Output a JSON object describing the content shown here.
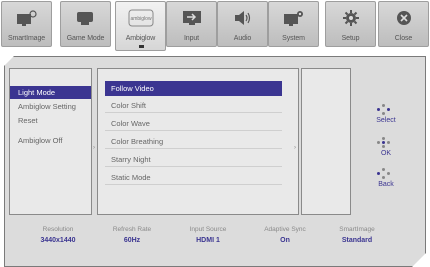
{
  "tabs": [
    {
      "label": "SmartImage",
      "icon": "smartimage-icon",
      "active": false
    },
    {
      "label": "Game Mode",
      "icon": "gamepad-icon",
      "active": false
    },
    {
      "label": "Ambiglow",
      "icon": "ambiglow-icon",
      "icon_text": "ambiglow",
      "active": true
    },
    {
      "label": "Input",
      "icon": "input-icon",
      "active": false
    },
    {
      "label": "Audio",
      "icon": "speaker-icon",
      "active": false
    },
    {
      "label": "System",
      "icon": "system-icon",
      "active": false
    },
    {
      "label": "Setup",
      "icon": "gear-icon",
      "active": false
    },
    {
      "label": "Close",
      "icon": "close-icon",
      "active": false
    }
  ],
  "menu": {
    "level1": [
      {
        "label": "Light Mode",
        "selected": true
      },
      {
        "label": "Ambiglow Setting",
        "selected": false
      },
      {
        "label": "Reset",
        "selected": false
      },
      {
        "label": "Ambiglow Off",
        "selected": false
      }
    ],
    "level2": [
      {
        "label": "Follow Video",
        "selected": true
      },
      {
        "label": "Color Shift",
        "selected": false
      },
      {
        "label": "Color Wave",
        "selected": false
      },
      {
        "label": "Color Breathing",
        "selected": false
      },
      {
        "label": "Starry Night",
        "selected": false
      },
      {
        "label": "Static Mode",
        "selected": false
      }
    ]
  },
  "controls": [
    {
      "label": "Select",
      "icon": "joystick-left-right-icon"
    },
    {
      "label": "OK",
      "icon": "joystick-press-icon"
    },
    {
      "label": "Back",
      "icon": "joystick-left-icon"
    }
  ],
  "status": [
    {
      "key": "Resolution",
      "value": "3440x1440"
    },
    {
      "key": "Refresh Rate",
      "value": "60Hz"
    },
    {
      "key": "Input Source",
      "value": "HDMI 1"
    },
    {
      "key": "Adaptive Sync",
      "value": "On"
    },
    {
      "key": "SmartImage",
      "value": "Standard"
    }
  ],
  "colors": {
    "accent": "#3b3591",
    "panel": "#dcdcdc",
    "tab": "#c8c8c8"
  }
}
